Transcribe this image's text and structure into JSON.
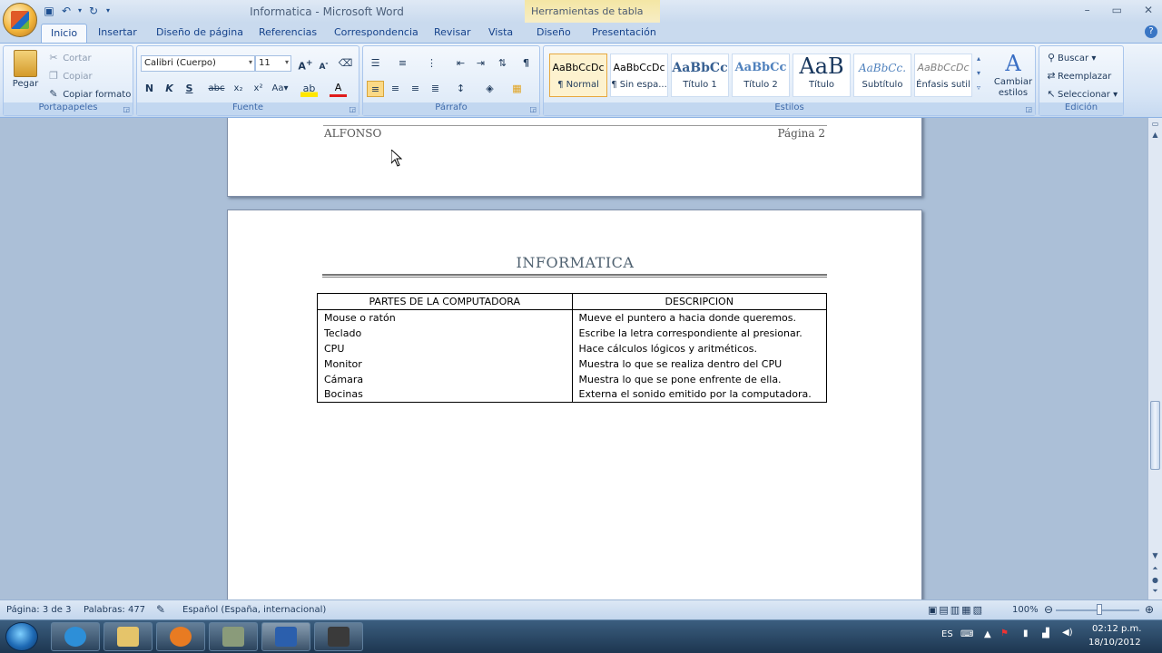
{
  "titlebar": {
    "title": "Informatica - Microsoft Word",
    "context_tab_title": "Herramientas de tabla",
    "quick_access": [
      "save-icon",
      "undo-icon",
      "dropdown-icon",
      "redo-icon",
      "customize-icon"
    ],
    "window_controls": [
      "–",
      "▭",
      "✕"
    ]
  },
  "tabs": [
    {
      "label": "Inicio",
      "active": true
    },
    {
      "label": "Insertar"
    },
    {
      "label": "Diseño de página"
    },
    {
      "label": "Referencias"
    },
    {
      "label": "Correspondencia"
    },
    {
      "label": "Revisar"
    },
    {
      "label": "Vista"
    },
    {
      "label": "Diseño"
    },
    {
      "label": "Presentación"
    }
  ],
  "ribbon": {
    "clipboard": {
      "label": "Portapapeles",
      "paste": "Pegar",
      "cut": "Cortar",
      "copy": "Copiar",
      "format_painter": "Copiar formato"
    },
    "font": {
      "label": "Fuente",
      "font_name": "Calibri (Cuerpo)",
      "font_size": "11"
    },
    "paragraph": {
      "label": "Párrafo"
    },
    "styles": {
      "label": "Estilos",
      "items": [
        {
          "sample": "AaBbCcDc",
          "name": "¶ Normal"
        },
        {
          "sample": "AaBbCcDc",
          "name": "¶ Sin espa..."
        },
        {
          "sample": "AaBbCc",
          "name": "Título 1"
        },
        {
          "sample": "AaBbCc",
          "name": "Título 2"
        },
        {
          "sample": "AaB",
          "name": "Título"
        },
        {
          "sample": "AaBbCc.",
          "name": "Subtítulo"
        },
        {
          "sample": "AaBbCcDc",
          "name": "Énfasis sutil"
        }
      ],
      "change_styles": "Cambiar estilos"
    },
    "editing": {
      "label": "Edición",
      "find": "Buscar",
      "replace": "Reemplazar",
      "select": "Seleccionar"
    }
  },
  "document": {
    "prev_page_footer": {
      "left": "ALFONSO",
      "right": "Página 2"
    },
    "title": "INFORMATICA",
    "table": {
      "headers": [
        "PARTES DE LA COMPUTADORA",
        "DESCRIPCION"
      ],
      "rows": [
        [
          "Mouse o ratón",
          "Mueve el puntero a hacia donde queremos."
        ],
        [
          "Teclado",
          "Escribe la letra correspondiente al presionar."
        ],
        [
          "CPU",
          "Hace cálculos lógicos y aritméticos."
        ],
        [
          "Monitor",
          "Muestra lo que se realiza dentro del CPU"
        ],
        [
          "Cámara",
          "Muestra lo que se pone enfrente de ella."
        ],
        [
          "Bocinas",
          "Externa el sonido emitido por la computadora."
        ]
      ]
    }
  },
  "statusbar": {
    "page": "Página: 3 de 3",
    "words": "Palabras: 477",
    "language": "Español (España, internacional)",
    "zoom": "100%"
  },
  "taskbar": {
    "apps": [
      {
        "icon": "internet-explorer-icon",
        "color": "#2d8fd8"
      },
      {
        "icon": "folder-icon",
        "color": "#e5c46a"
      },
      {
        "icon": "media-player-icon",
        "color": "#e87b22"
      },
      {
        "icon": "app-icon",
        "color": "#8a9b7a"
      },
      {
        "icon": "word-icon",
        "color": "#2b5fad"
      },
      {
        "icon": "camera-app-icon",
        "color": "#3a3a3a"
      }
    ],
    "tray": {
      "lang": "ES",
      "time": "02:12 p.m.",
      "date": "18/10/2012"
    }
  }
}
